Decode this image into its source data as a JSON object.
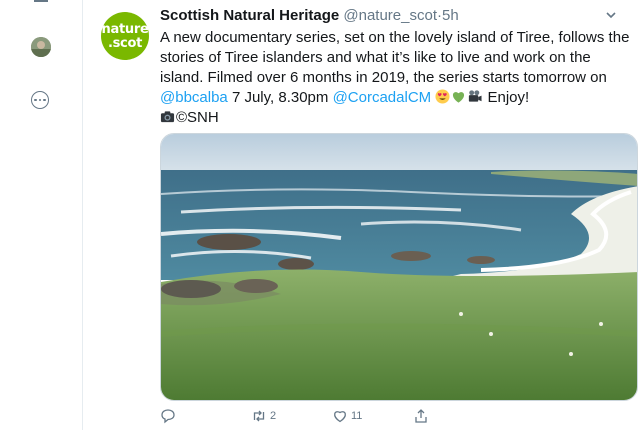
{
  "tweet": {
    "avatar_line1": "nature",
    "avatar_line2": ".scot",
    "display_name": "Scottish Natural Heritage",
    "handle": "@nature_scot",
    "separator": "·",
    "time": "5h",
    "text": {
      "part1": "A new documentary series, set on the lovely island of Tiree, follows the stories of Tiree islanders and what it’s like to live and work on the island. Filmed over 6 months in 2019, the series starts tomorrow on ",
      "mention1": "@bbcalba",
      "part2": " 7 July, 8.30pm ",
      "mention2": "@CorcadalCM",
      "part3": " Enjoy!",
      "credit": "©SNH"
    },
    "media_alt": "Coastal view of Tiree: green grassland leading down to a white sandy bay with waves and rocks"
  },
  "actions": {
    "reply_count": "",
    "retweet_count": "2",
    "like_count": "11"
  },
  "colors": {
    "brand_green": "#7ab800",
    "link_blue": "#1da1f2",
    "secondary_text": "#657786"
  },
  "icons": [
    "more-icon",
    "caret-down-icon",
    "heart-eyes-emoji",
    "green-heart-emoji",
    "video-camera-emoji",
    "camera-emoji",
    "reply-icon",
    "retweet-icon",
    "like-icon",
    "share-icon"
  ]
}
